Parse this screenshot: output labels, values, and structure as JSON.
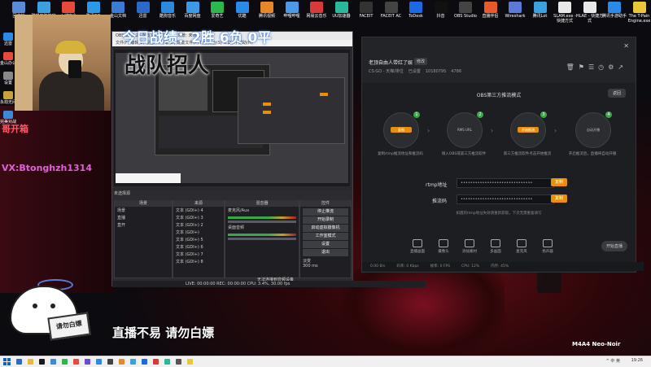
{
  "desktop_icons_row1": [
    "回收站",
    "联想电脑管家",
    "火绒安全",
    "腾讯QQ",
    "金山文档",
    "迅雷",
    "酷狗音乐",
    "百度网盘",
    "爱奇艺",
    "优酷",
    "腾讯视频",
    "哔哩哔哩",
    "网易云音乐",
    "UU加速器",
    "FACEIT",
    "FACEIT AC",
    "ToDesk",
    "抖音",
    "OBS Studio",
    "直播伴侣",
    "Wireshark",
    "腾讯Lot",
    "SLAM.exe - 快捷方式",
    "HLAE - 快捷方式",
    "腾讯手游助手",
    "The T-Pain Engine.exe"
  ],
  "desktop_icons_left": [
    "迅雷",
    "金山办公",
    "设置",
    "永劫无间",
    "完美对战"
  ],
  "overlay": {
    "record": "今日战绩：2胜 6负 0平",
    "recruit": "战队招人",
    "side_text": "哥开箱",
    "vx": "VX:Btonghzh1314",
    "bottom_text": "直播不易 请勿白嫖",
    "wallpaper_caption": "M4A4 Neo-Noir",
    "cat_sign": "请勿白嫖"
  },
  "obs": {
    "window_title": "OBS 30.0.2 - 配置文件: 未命名 - 场景: 未命名",
    "menu": "文件(F)  编辑(E)  视图(V)  停靠(D)  配置文件(P)  场景集合(S)  工具(T)  帮助(H)",
    "source_label": "未选择源",
    "panels": {
      "scenes": "场景",
      "sources": "来源",
      "mixer": "混音器",
      "transitions": "场景转场",
      "controls": "控件"
    },
    "scene_items": [
      "场景",
      "直播",
      "直开"
    ],
    "source_items": [
      "文本 (GDI+) 4",
      "文本 (GDI+) 3",
      "文本 (GDI+) 2",
      "文本 (GDI+)",
      "文本 (GDI+) 5",
      "文本 (GDI+) 6",
      "文本 (GDI+) 7",
      "文本 (GDI+) 8"
    ],
    "mixer_items": [
      "麦克风/Aux",
      "桌面音频"
    ],
    "controls": [
      "停止推流",
      "开始录制",
      "启动虚拟摄像机",
      "工作室模式",
      "设置",
      "退出"
    ],
    "transition_select": "淡变",
    "transition_duration": "300 ms",
    "status_bar": "LIVE: 00:00:00   REC: 00:00:00   CPU: 3.4%, 30.00 fps",
    "capture_caption": "直播不易 请勿白嫖",
    "notice": "无法连接到音频设备"
  },
  "app": {
    "room_title": "老顶自由人带红了娱",
    "room_badge": "修改",
    "room_meta": [
      "CS:GO - 天梯/排位",
      "已设置",
      "1018079S",
      "4786"
    ],
    "mode_title": "OBS第三方推流模式",
    "return_button": "返回",
    "steps": [
      {
        "pill": "复制",
        "label": "复制rtmp推流地址和推流码"
      },
      {
        "pill": "RMS URL",
        "label": "填入OBS或第三方推流软件"
      },
      {
        "pill": "开始推流",
        "label": "第三方推流软件点击开始推流"
      },
      {
        "pill": "自动开播",
        "label": "开启推流后，直播将自动开播"
      }
    ],
    "rtmp_label": "rtmp地址",
    "rtmp_value": "••••••••••••••••••••••••••••••",
    "key_label": "推流码",
    "key_value": "••••••••••••••••••••••••••••••",
    "copy_button": "复制",
    "hint": "如遇到rtmp地址失效请重新获取，下次无需重复填写",
    "toolbar": [
      "直播画面",
      "摄像头",
      "添加素材",
      "多画面",
      "麦克风",
      "扬声器"
    ],
    "go_live": "开始直播",
    "status": [
      "0.00 B/s",
      "码率: 0 Kbps",
      "帧率: 0 FPS",
      "CPU: 12%",
      "内存: 45%"
    ]
  },
  "taskbar": {
    "tray": "^  中  英",
    "clock": "19:26"
  },
  "colors": {
    "accent": "#e8900e",
    "obs_bg": "#2a2a2e",
    "app_bg": "#1d1e22"
  }
}
